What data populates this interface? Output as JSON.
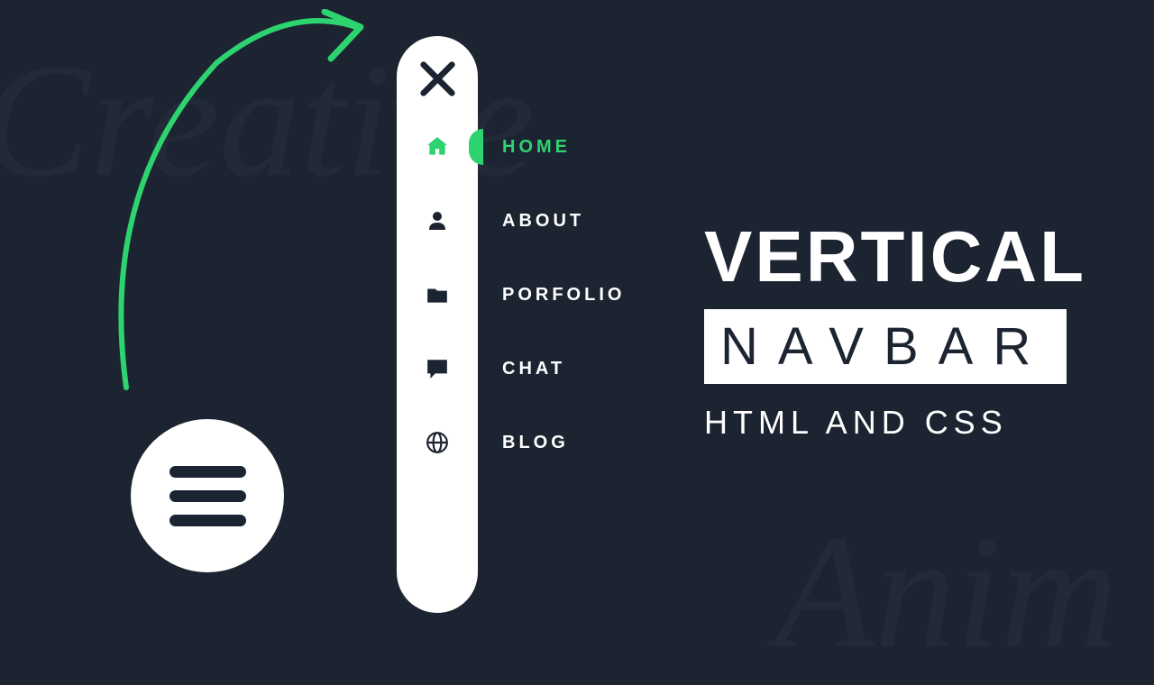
{
  "bg": {
    "top": "Creative",
    "bottom": "Anim"
  },
  "nav": {
    "items": [
      {
        "label": "HOME"
      },
      {
        "label": "ABOUT"
      },
      {
        "label": "PORFOLIO"
      },
      {
        "label": "CHAT"
      },
      {
        "label": "BLOG"
      }
    ]
  },
  "title": {
    "line1": "VERTICAL",
    "line2": "NAVBAR",
    "line3": "HTML AND CSS"
  },
  "colors": {
    "accent": "#2dd36f",
    "bg": "#1c2431"
  }
}
